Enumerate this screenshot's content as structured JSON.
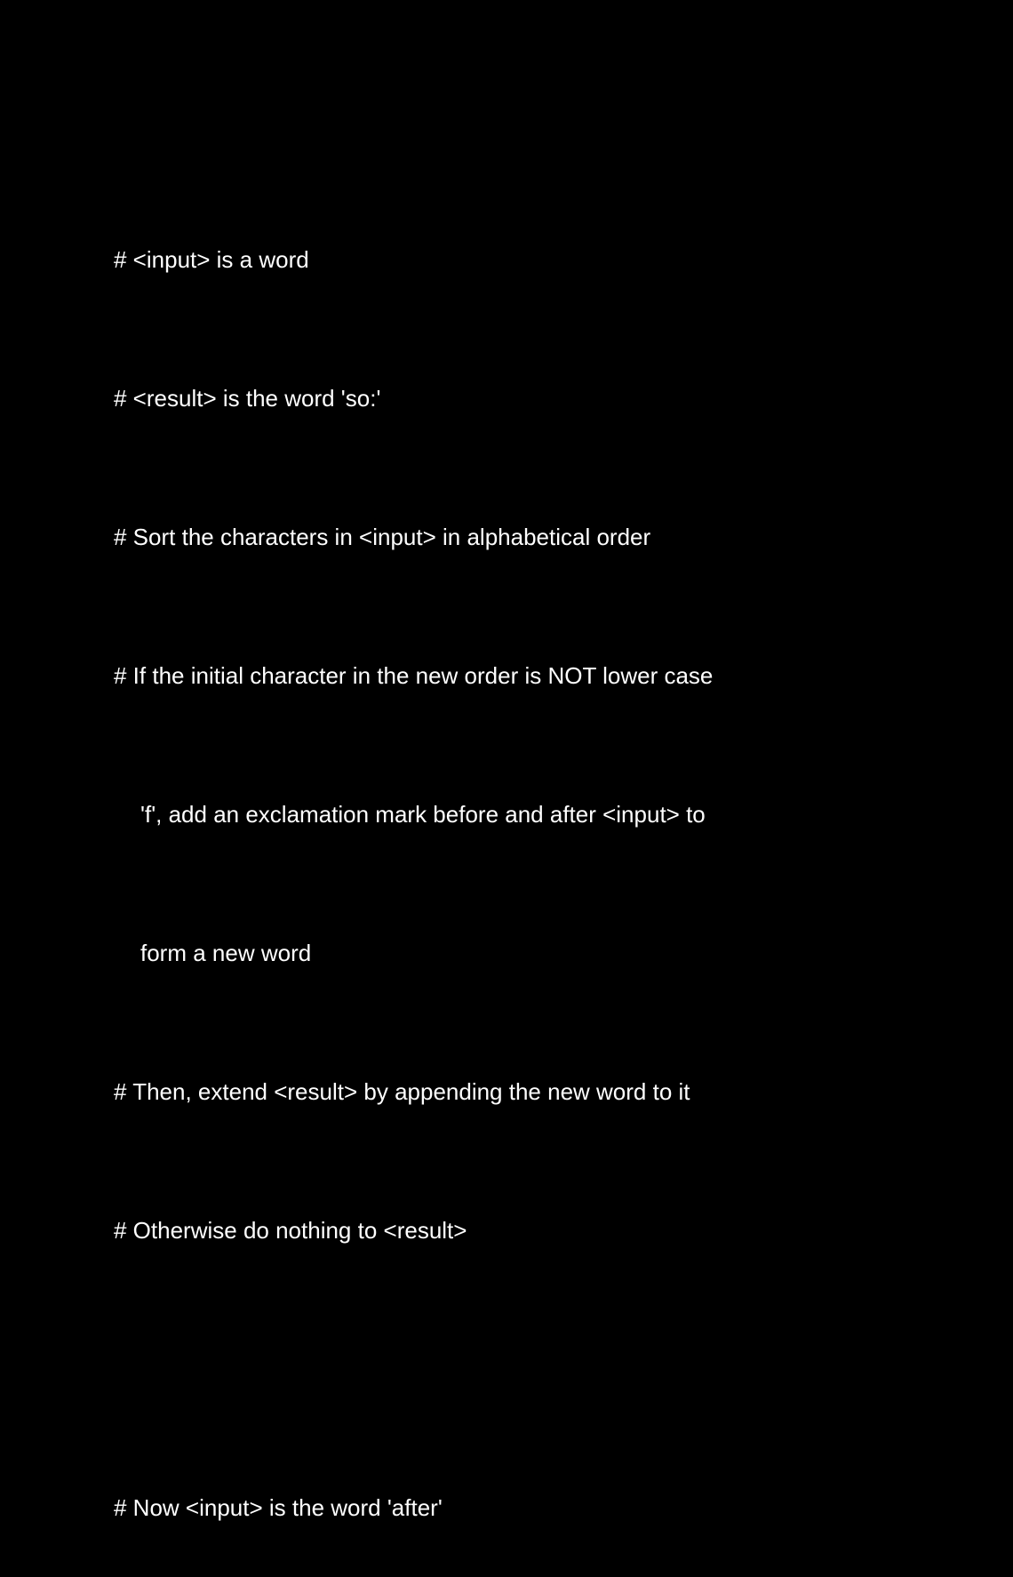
{
  "colors": {
    "background": "#000000",
    "text": "#ffffff"
  },
  "lines": [
    "# <input> is a word",
    "# <result> is the word 'so:'",
    "# Sort the characters in <input> in alphabetical order",
    "# If the initial character in the new order is NOT lower case",
    "'f', add an exclamation mark before and after <input> to",
    "form a new word",
    "# Then, extend <result> by appending the new word to it",
    "# Otherwise do nothing to <result>",
    "",
    "# Now <input> is the word 'after'"
  ]
}
